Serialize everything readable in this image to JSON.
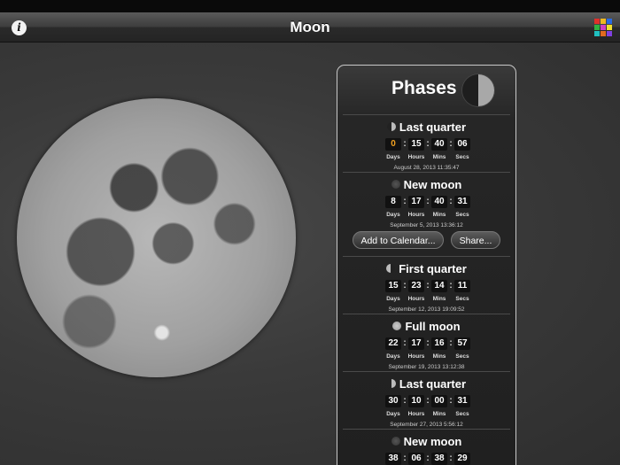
{
  "app": {
    "title": "Moon",
    "info_label": "i"
  },
  "colors": [
    "#e0302a",
    "#f0b820",
    "#2a6be0",
    "#30b040",
    "#d040c0",
    "#f0e030",
    "#20c0c0",
    "#e06a20",
    "#8040e0"
  ],
  "panel": {
    "title": "Phases"
  },
  "units": [
    "Days",
    "Hours",
    "Mins",
    "Secs"
  ],
  "phases": [
    {
      "name": "Last quarter",
      "icon": "last-quarter-icon",
      "values": [
        "0",
        "15",
        "40",
        "06"
      ],
      "date": "August 28, 2013  11:35:47"
    },
    {
      "name": "New moon",
      "icon": "new-moon-icon",
      "values": [
        "8",
        "17",
        "40",
        "31"
      ],
      "date": "September 5, 2013  13:36:12"
    },
    {
      "name": "First quarter",
      "icon": "first-quarter-icon",
      "values": [
        "15",
        "23",
        "14",
        "11"
      ],
      "date": "September 12, 2013  19:09:52"
    },
    {
      "name": "Full moon",
      "icon": "full-moon-icon",
      "values": [
        "22",
        "17",
        "16",
        "57"
      ],
      "date": "September 19, 2013  13:12:38"
    },
    {
      "name": "Last quarter",
      "icon": "last-quarter-icon",
      "values": [
        "30",
        "10",
        "00",
        "31"
      ],
      "date": "September 27, 2013  5:56:12"
    },
    {
      "name": "New moon",
      "icon": "new-moon-icon",
      "values": [
        "38",
        "06",
        "38",
        "29"
      ],
      "date": ""
    }
  ],
  "actions": {
    "calendar_label": "Add to Calendar...",
    "share_label": "Share..."
  }
}
